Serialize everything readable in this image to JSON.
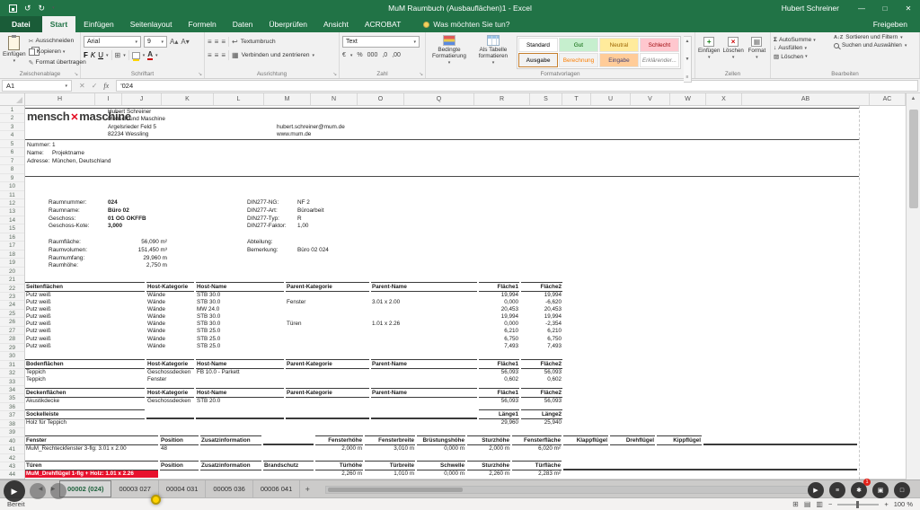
{
  "titlebar": {
    "title": "MuM Raumbuch (Ausbauflächen)1 - Excel",
    "user": "Hubert Schreiner"
  },
  "ribbon": {
    "tabs": [
      "Datei",
      "Start",
      "Einfügen",
      "Seitenlayout",
      "Formeln",
      "Daten",
      "Überprüfen",
      "Ansicht",
      "ACROBAT"
    ],
    "active_tab": "Start",
    "tellme": "Was möchten Sie tun?",
    "share": "Freigeben",
    "groups": {
      "clipboard": {
        "label": "Zwischenablage",
        "paste": "Einfügen",
        "cut": "Ausschneiden",
        "copy": "Kopieren",
        "painter": "Format übertragen"
      },
      "font": {
        "label": "Schriftart",
        "family": "Arial",
        "size": "9",
        "bold": "F",
        "italic": "K",
        "underline": "U"
      },
      "align": {
        "label": "Ausrichtung",
        "wrap": "Textumbruch",
        "merge": "Verbinden und zentrieren"
      },
      "number": {
        "label": "Zahl",
        "format": "Text",
        "currency": "€",
        "percent": "%",
        "thousand": "000",
        "dec1": ",0",
        "dec2": ",00"
      },
      "styles": {
        "label": "Formatvorlagen",
        "conditional": "Bedingte Formatierung",
        "table": "Als Tabelle formatieren",
        "cells": [
          {
            "label": "Standard",
            "bg": "#ffffff",
            "color": "#000000"
          },
          {
            "label": "Gut",
            "bg": "#c6efce",
            "color": "#006100"
          },
          {
            "label": "Neutral",
            "bg": "#ffeb9c",
            "color": "#9c6500"
          },
          {
            "label": "Schlecht",
            "bg": "#ffc7ce",
            "color": "#9c0006"
          },
          {
            "label": "Ausgabe",
            "bg": "#f2f2f2",
            "color": "#3f3f3f",
            "bold": true,
            "selected": true
          },
          {
            "label": "Berechnung",
            "bg": "#f2f2f2",
            "color": "#fa7d00"
          },
          {
            "label": "Eingabe",
            "bg": "#ffcc99",
            "color": "#3f3f76"
          },
          {
            "label": "Erklärender...",
            "bg": "#ffffff",
            "color": "#7f7f7f",
            "italic": true
          }
        ]
      },
      "cells": {
        "label": "Zellen",
        "insert": "Einfügen",
        "del": "Löschen",
        "format": "Format"
      },
      "editing": {
        "label": "Bearbeiten",
        "autosum": "AutoSumme",
        "fill": "Ausfüllen",
        "clear": "Löschen",
        "sort": "Sortieren und Filtern",
        "find": "Suchen und Auswählen"
      }
    }
  },
  "formula_bar": {
    "name_box": "A1",
    "value": "'024"
  },
  "grid": {
    "columns": [
      "H",
      "I",
      "J",
      "K",
      "L",
      "M",
      "N",
      "O",
      "Q",
      "R",
      "S",
      "T",
      "U",
      "V",
      "W",
      "X",
      "AB",
      "AC"
    ],
    "row_count": 44
  },
  "doc": {
    "logo": {
      "word1": "mensch",
      "mark": "✕",
      "word2": "maschine"
    },
    "sender": [
      "Hubert Schreiner",
      "Mensch und Maschine",
      "Argelsrieder Feld 5",
      "82234 Wessling"
    ],
    "sender_links": [
      "hubert.schreiner@mum.de",
      "www.mum.de"
    ],
    "project": [
      {
        "label": "Nummer:",
        "value": "1"
      },
      {
        "label": "Name:",
        "value": "Projektname"
      },
      {
        "label": "Adresse:",
        "value": "München, Deutschland"
      }
    ],
    "room": [
      {
        "label": "Raumnummer:",
        "value": "024"
      },
      {
        "label": "Raumname:",
        "value": "Büro 02"
      },
      {
        "label": "Geschoss:",
        "value": "01 OG OKFFB"
      },
      {
        "label": "Geschoss-Kote:",
        "value": "3,000"
      }
    ],
    "din": [
      {
        "label": "DIN277-NG:",
        "value": "NF 2"
      },
      {
        "label": "DIN277-Art:",
        "value": "Büroarbeit"
      },
      {
        "label": "DIN277-Typ:",
        "value": "R"
      },
      {
        "label": "DIN277-Faktor:",
        "value": "1,00"
      }
    ],
    "metrics": [
      {
        "label": "Raumfläche:",
        "value": "56,090 m²"
      },
      {
        "label": "Raumvolumen:",
        "value": "151,450 m³"
      },
      {
        "label": "Raumumfang:",
        "value": "29,960 m"
      },
      {
        "label": "Raumhöhe:",
        "value": "2,750 m"
      }
    ],
    "extra": [
      {
        "label": "Abteilung:",
        "value": ""
      },
      {
        "label": "Bemerkung:",
        "value": "Büro 02 024"
      }
    ]
  },
  "tables": {
    "seiten": {
      "headers": [
        "Seitenflächen",
        "Host-Kategorie",
        "Host-Name",
        "Parent-Kategorie",
        "Parent-Name",
        "Fläche1",
        "Fläche2"
      ],
      "rows": [
        [
          "Putz weiß",
          "Wände",
          "STB 30.0",
          "",
          "",
          "19,994",
          "19,994"
        ],
        [
          "Putz weiß",
          "Wände",
          "STB 30.0",
          "Fenster",
          "3.01 x 2.00",
          "0,000",
          "-6,620"
        ],
        [
          "Putz weiß",
          "Wände",
          "MW 24.0",
          "",
          "",
          "20,453",
          "20,453"
        ],
        [
          "Putz weiß",
          "Wände",
          "STB 30.0",
          "",
          "",
          "19,994",
          "19,994"
        ],
        [
          "Putz weiß",
          "Wände",
          "STB 30.0",
          "Türen",
          "1.01 x 2.26",
          "0,000",
          "-2,354"
        ],
        [
          "Putz weiß",
          "Wände",
          "STB 25.0",
          "",
          "",
          "6,210",
          "6,210"
        ],
        [
          "Putz weiß",
          "Wände",
          "STB 25.0",
          "",
          "",
          "6,750",
          "6,750"
        ],
        [
          "Putz weiß",
          "Wände",
          "STB 25.0",
          "",
          "",
          "7,493",
          "7,493"
        ]
      ]
    },
    "boden": {
      "headers": [
        "Bodenflächen",
        "Host-Kategorie",
        "Host-Name",
        "Parent-Kategorie",
        "Parent-Name",
        "Fläche1",
        "Fläche2"
      ],
      "rows": [
        [
          "Teppich",
          "Geschossdecken",
          "FB 10.0 - Parkett",
          "",
          "",
          "56,093",
          "56,093"
        ],
        [
          "Teppich",
          "Fenster",
          "",
          "",
          "",
          "0,602",
          "0,602"
        ]
      ]
    },
    "decken": {
      "headers": [
        "Deckenflächen",
        "Host-Kategorie",
        "Host-Name",
        "Parent-Kategorie",
        "Parent-Name",
        "Fläche1",
        "Fläche2"
      ],
      "rows": [
        [
          "Akustikdecke",
          "Geschossdecken",
          "STB 20.0",
          "",
          "",
          "56,093",
          "56,093"
        ]
      ]
    },
    "sockel": {
      "headers": [
        "Sockelleiste",
        "",
        "",
        "",
        "",
        "Länge1",
        "Länge2"
      ],
      "rows": [
        [
          "Holz für Teppich",
          "",
          "",
          "",
          "",
          "29,960",
          "25,940"
        ]
      ]
    },
    "fenster": {
      "headers": [
        "Fenster",
        "Position",
        "Zusatzinformation",
        "",
        "Fensterhöhe",
        "Fensterbreite",
        "Brüstungshöhe",
        "Sturzhöhe",
        "Fensterfläche",
        "Klappflügel",
        "Drehflügel",
        "Kippflügel",
        ""
      ],
      "rows": [
        [
          "MuM_Rechteckfenster 3-flg: 3.01 x 2.00",
          "48",
          "",
          "",
          "2,000 m",
          "3,010 m",
          "0,000 m",
          "2,000 m",
          "6,020 m²",
          "",
          "",
          "",
          ""
        ]
      ]
    },
    "tueren": {
      "headers": [
        "Türen",
        "Position",
        "Zusatzinformation",
        "Brandschutz",
        "Türhöhe",
        "Türbreite",
        "Schwelle",
        "Sturzhöhe",
        "Türfläche",
        ""
      ],
      "rows": [
        [
          "MuM_Drehflügel 1-flg + Holz: 1.01 x 2.26",
          "",
          "",
          "",
          "2,260 m",
          "1,010 m",
          "0,000 m",
          "2,260 m",
          "2,283 m²",
          ""
        ]
      ]
    }
  },
  "sheet_bar": {
    "tabs": [
      "00002 (024)",
      "00003 027",
      "00004 031",
      "00005 036",
      "00006 041"
    ]
  },
  "status_bar": {
    "mode": "Bereit",
    "zoom": "100 %"
  },
  "player": {
    "badge": "1"
  },
  "icons": {
    "save": "▣",
    "undo": "↺",
    "redo": "↻",
    "caret": "▾",
    "min": "—",
    "max": "□",
    "close": "✕",
    "cut": "✂",
    "paint": "✎",
    "grow": "A▴",
    "shrink": "A▾",
    "borders": "⊞",
    "align": "≡",
    "wrap": "↩",
    "merge": "▦",
    "launcher": "↘",
    "sigma": "Σ",
    "fill": "↓",
    "erase": "▨",
    "sortAZ": "A↓Z",
    "cancel": "✕",
    "enter": "✓",
    "fx": "fx",
    "prev": "◀",
    "next": "▶",
    "plus": "+",
    "play": "▶",
    "menu": "≡",
    "star": "✱",
    "pip": "▣",
    "square": "□",
    "up": "▲",
    "down": "▼",
    "view_normal": "⊞",
    "view_layout": "▤",
    "view_break": "▥",
    "zoom_minus": "−",
    "zoom_plus": "+",
    "cellformat": "▦"
  }
}
